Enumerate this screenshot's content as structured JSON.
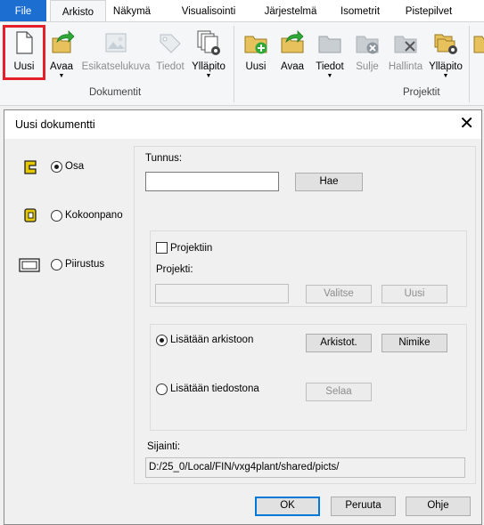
{
  "ribbon": {
    "tabs": [
      "File",
      "Arkisto",
      "Näkymä",
      "Visualisointi",
      "Järjestelmä",
      "Isometrit",
      "Pistepilvet"
    ],
    "groups": {
      "dokumentit": "Dokumentit",
      "projektit": "Projektit"
    },
    "doc_buttons": [
      "Uusi",
      "Avaa",
      "Esikatselukuva",
      "Tiedot",
      "Ylläpito"
    ],
    "proj_buttons": [
      "Uusi",
      "Avaa",
      "Tiedot",
      "Sulje",
      "Hallinta",
      "Ylläpito"
    ]
  },
  "dialog": {
    "title": "Uusi dokumentti",
    "close": "✕",
    "types": [
      "Osa",
      "Kokoonpano",
      "Piirustus"
    ],
    "tunnus_label": "Tunnus:",
    "tunnus_value": "",
    "hae": "Hae",
    "projektiin": "Projektiin",
    "projekti_label": "Projekti:",
    "projekti_value": "",
    "valitse": "Valitse",
    "uusi": "Uusi",
    "lisataan_arkistoon": "Lisätään arkistoon",
    "arkistot": "Arkistot.",
    "nimike": "Nimike",
    "lisataan_tiedostona": "Lisätään tiedostona",
    "selaa": "Selaa",
    "sijainti_label": "Sijainti:",
    "sijainti_value": "D:/25_0/Local/FIN/vxg4plant/shared/picts/",
    "ok": "OK",
    "peruuta": "Peruuta",
    "ohje": "Ohje"
  },
  "colors": {
    "file_tab": "#1c6fd1",
    "highlight": "#e5202a",
    "default_button": "#0078d7",
    "green": "#2ea836",
    "folder": "#e7c25c"
  }
}
